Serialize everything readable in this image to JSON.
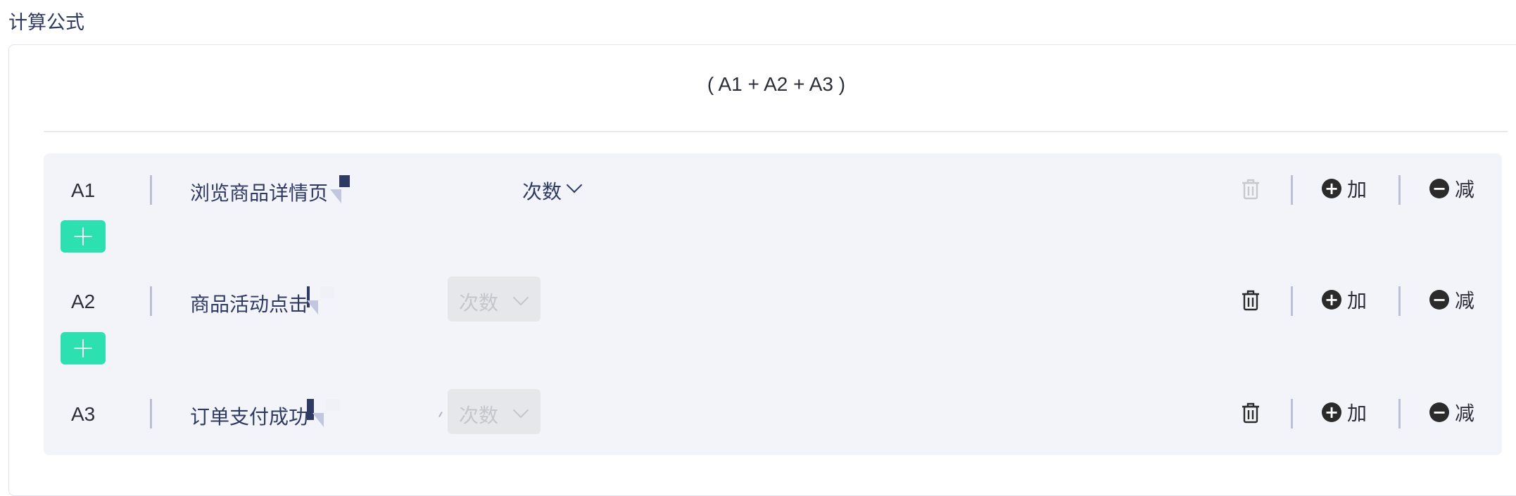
{
  "section": {
    "title": "计算公式"
  },
  "formula": {
    "text": "( A1 + A2 + A3 )"
  },
  "rows": [
    {
      "id": "A1",
      "event": "浏览商品详情页",
      "metric": "次数",
      "metric_state": "active",
      "delete_state": "disabled",
      "plus_label": "加",
      "minus_label": "减"
    },
    {
      "id": "A2",
      "event": "商品活动点击",
      "metric": "次数",
      "metric_state": "disabled",
      "delete_state": "enabled",
      "plus_label": "加",
      "minus_label": "减"
    },
    {
      "id": "A3",
      "event": "订单支付成功",
      "metric": "次数",
      "metric_state": "disabled",
      "delete_state": "enabled",
      "plus_label": "加",
      "minus_label": "减"
    }
  ],
  "add_button": {
    "icon": "plus-icon"
  },
  "colors": {
    "accent": "#2de0b0",
    "text": "#2f3a63",
    "rows_bg": "#f3f4f9"
  }
}
